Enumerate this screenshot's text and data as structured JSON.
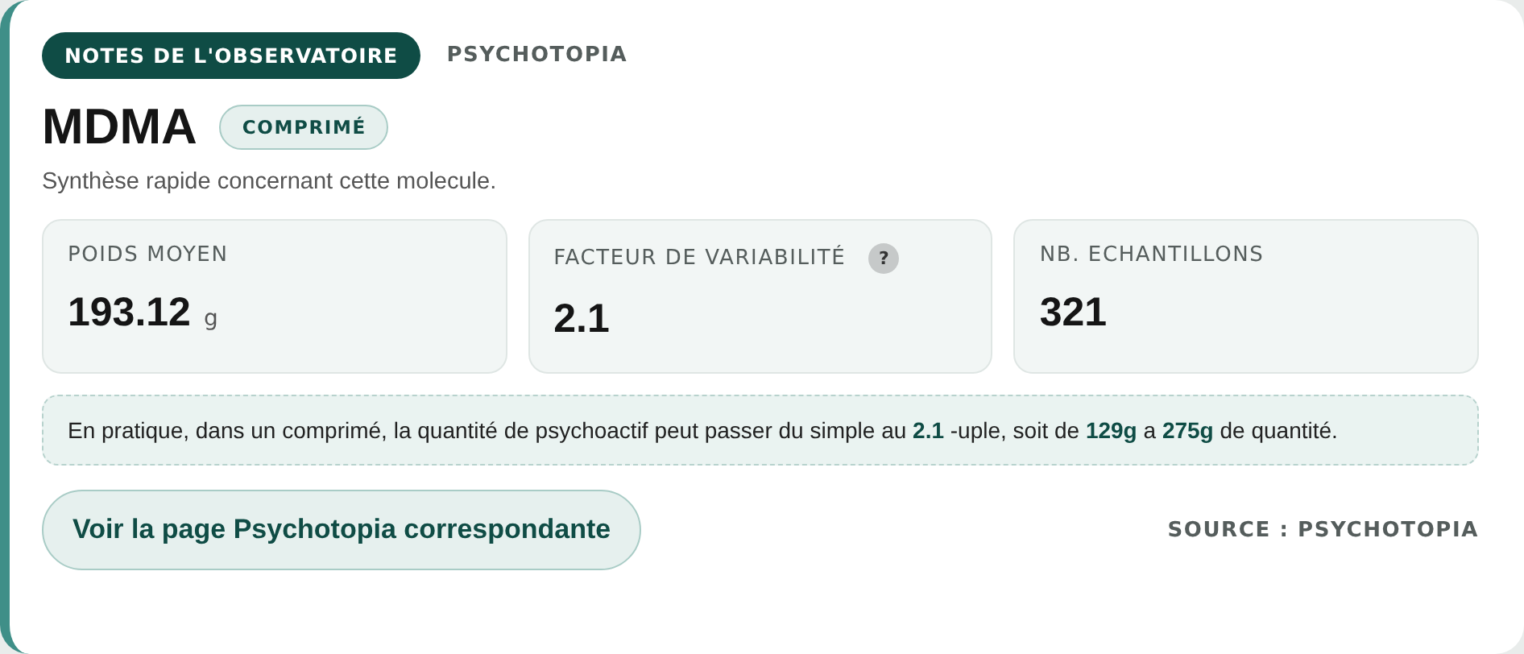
{
  "header": {
    "badge": "NOTES DE L'OBSERVATOIRE",
    "source_label": "PSYCHOTOPIA"
  },
  "title": "MDMA",
  "form_tag": "COMPRIMÉ",
  "subtitle": "Synthèse rapide concernant cette molecule.",
  "stats": [
    {
      "label": "POIDS MOYEN",
      "value": "193.12",
      "unit": "g"
    },
    {
      "label": "FACTEUR DE VARIABILITÉ",
      "value": "2.1",
      "help": "?"
    },
    {
      "label": "NB. ECHANTILLONS",
      "value": "321"
    }
  ],
  "note": "En pratique, dans un comprimé, la quantité de psychoactif peut passer du simple au **2.1** -uple, soit de **129g** a **275g** de quantité.",
  "link_button": "Voir la page Psychotopia correspondante",
  "source": "SOURCE : PSYCHOTOPIA"
}
